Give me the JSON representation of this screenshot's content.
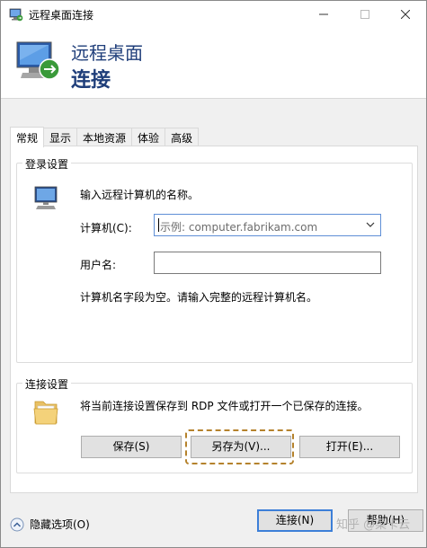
{
  "window": {
    "title": "远程桌面连接",
    "minimize_icon": "minimize-icon",
    "maximize_icon": "maximize-icon",
    "close_icon": "close-icon"
  },
  "header": {
    "line1": "远程桌面",
    "line2": "连接",
    "icon": "remote-desktop-icon"
  },
  "tabs": [
    "常规",
    "显示",
    "本地资源",
    "体验",
    "高级"
  ],
  "active_tab": "常规",
  "login": {
    "group_title": "登录设置",
    "prompt": "输入远程计算机的名称。",
    "computer_label": "计算机(C):",
    "computer_placeholder": "示例: computer.fabrikam.com",
    "username_label": "用户名:",
    "username_value": "",
    "warning": "计算机名字段为空。请输入完整的远程计算机名。"
  },
  "connection": {
    "group_title": "连接设置",
    "description": "将当前连接设置保存到 RDP 文件或打开一个已保存的连接。",
    "save_label": "保存(S)",
    "save_as_label": "另存为(V)...",
    "open_label": "打开(E)..."
  },
  "footer": {
    "options_label": "隐藏选项(O)",
    "connect_label": "连接(N)",
    "help_label": "帮助(H)",
    "watermark": "知乎 @菜卡云"
  },
  "colors": {
    "title_blue": "#1f3e7a",
    "focus_blue": "#3c7fd8",
    "highlight": "#b5822c"
  }
}
